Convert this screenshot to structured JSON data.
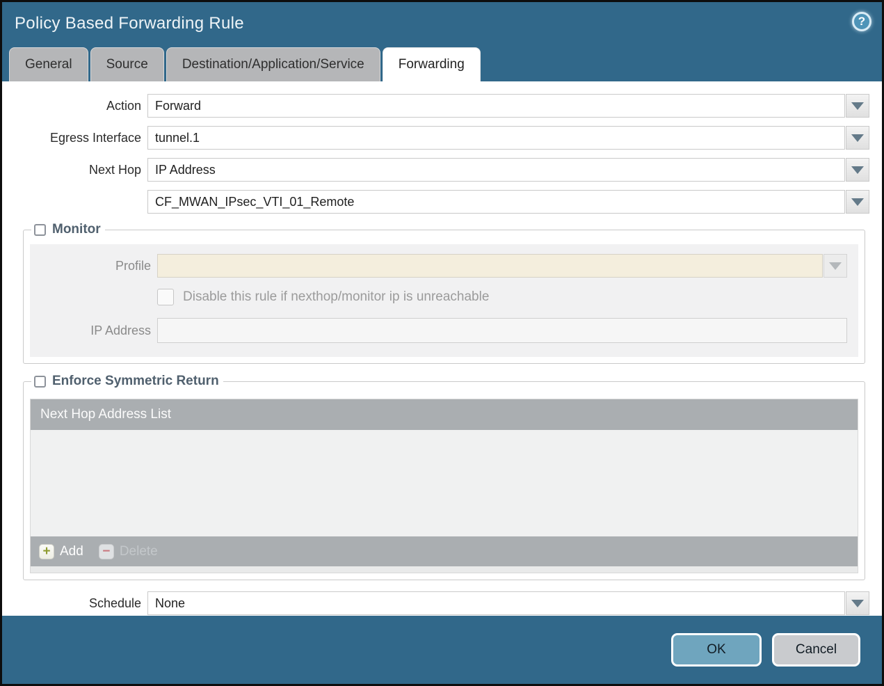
{
  "dialog": {
    "title": "Policy Based Forwarding Rule",
    "help_glyph": "?"
  },
  "tabs": [
    {
      "label": "General",
      "active": false
    },
    {
      "label": "Source",
      "active": false
    },
    {
      "label": "Destination/Application/Service",
      "active": false
    },
    {
      "label": "Forwarding",
      "active": true
    }
  ],
  "form": {
    "action": {
      "label": "Action",
      "value": "Forward"
    },
    "egress_interface": {
      "label": "Egress Interface",
      "value": "tunnel.1"
    },
    "next_hop": {
      "label": "Next Hop",
      "value": "IP Address"
    },
    "next_hop_address": {
      "value": "CF_MWAN_IPsec_VTI_01_Remote"
    },
    "schedule": {
      "label": "Schedule",
      "value": "None"
    }
  },
  "monitor": {
    "legend": "Monitor",
    "checked": false,
    "profile": {
      "label": "Profile",
      "value": ""
    },
    "disable_rule_label": "Disable this rule if nexthop/monitor ip is unreachable",
    "disable_rule_checked": false,
    "ip_address": {
      "label": "IP Address",
      "value": ""
    }
  },
  "enforce_symmetric_return": {
    "legend": "Enforce Symmetric Return",
    "checked": false,
    "table_header": "Next Hop Address List",
    "rows": [],
    "add_label": "Add",
    "add_glyph": "+",
    "delete_label": "Delete",
    "delete_glyph": "−",
    "delete_enabled": false
  },
  "footer": {
    "ok_label": "OK",
    "cancel_label": "Cancel"
  },
  "colors": {
    "titlebar_teal": "#31688A",
    "ok_button_teal": "#6FA5BE",
    "tab_inactive_gray": "#B5B6B8",
    "table_header_gray": "#AAAEB1",
    "profile_disabled_cream": "#F4EEDD",
    "legend_slate": "#50606E",
    "add_plus_olive": "#8F9C31",
    "delete_minus_red": "#C9777F"
  }
}
